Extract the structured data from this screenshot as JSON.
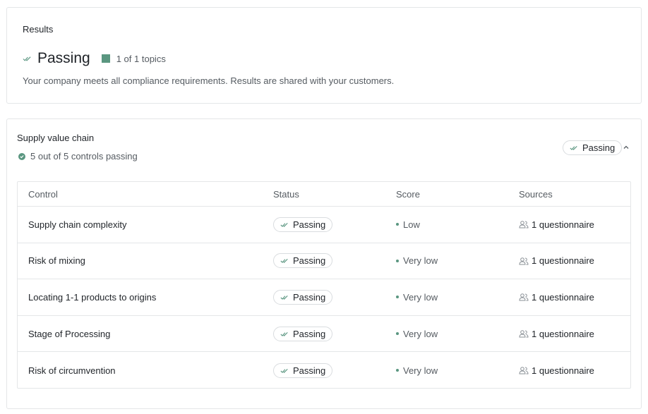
{
  "results": {
    "title": "Results",
    "status": "Passing",
    "topics_count": "1 of 1 topics",
    "description": "Your company meets all compliance requirements. Results are shared with your customers."
  },
  "topic": {
    "title": "Supply value chain",
    "summary": "5 out of 5 controls passing",
    "status": "Passing"
  },
  "table": {
    "headers": {
      "control": "Control",
      "status": "Status",
      "score": "Score",
      "sources": "Sources"
    },
    "rows": [
      {
        "control": "Supply chain complexity",
        "status": "Passing",
        "score": "Low",
        "sources": "1 questionnaire"
      },
      {
        "control": "Risk of mixing",
        "status": "Passing",
        "score": "Very low",
        "sources": "1 questionnaire"
      },
      {
        "control": "Locating 1-1 products to origins",
        "status": "Passing",
        "score": "Very low",
        "sources": "1 questionnaire"
      },
      {
        "control": "Stage of Processing",
        "status": "Passing",
        "score": "Very low",
        "sources": "1 questionnaire"
      },
      {
        "control": "Risk of circumvention",
        "status": "Passing",
        "score": "Very low",
        "sources": "1 questionnaire"
      }
    ]
  },
  "icons": {
    "check": "double-check-icon",
    "sources": "users-icon",
    "collapse": "chevron-up-icon"
  },
  "colors": {
    "accent": "#5a9680",
    "border": "#e4e6e8",
    "muted_text": "#555b61"
  }
}
